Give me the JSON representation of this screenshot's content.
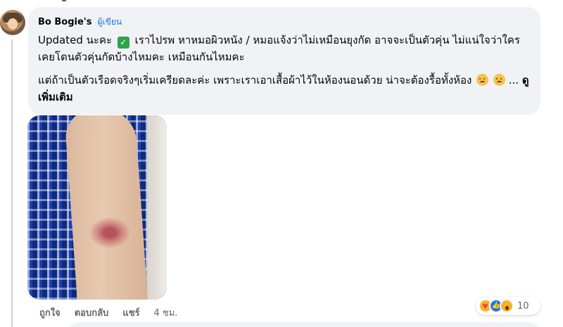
{
  "comment": {
    "author": "Bo Bogie's",
    "author_badge": "ผู้เขียน",
    "para1_start": "Updated นะคะ",
    "para1_rest": "เราไปรพ หาหมอผิวหนัง / หมอแจ้งว่าไม่เหมือนยุงกัด อาจจะเป็นตัวคุ่น ไม่แน่ใจว่าใครเคยโดนตัวคุ่นกัดบ้างไหมคะ เหมือนกันไหมคะ",
    "para2": "แต่ถ้าเป็นตัวเรือดจริงๆเริ่มเครียดละค่ะ เพราะเราเอาเสื้อผ้าไว้ในห้องนอนด้วย น่าจะต้องรื้อทั้งห้อง",
    "ellipsis": "...",
    "see_more": "ดูเพิ่มเติม",
    "check_icon": "white-check-mark-emoji",
    "face_icons": [
      "crying-face-emoji",
      "crying-face-emoji"
    ]
  },
  "actions": {
    "like": "ถูกใจ",
    "reply": "ตอบกลับ",
    "share": "แชร์",
    "time": "4 ชม."
  },
  "reactions": {
    "icons": [
      "care-reaction",
      "like-reaction",
      "wow-reaction"
    ],
    "count": "10"
  },
  "colors": {
    "bubble": "#f0f2f5",
    "badge": "#1b74e4",
    "muted": "#65676b",
    "like_blue": "#1877f2"
  }
}
